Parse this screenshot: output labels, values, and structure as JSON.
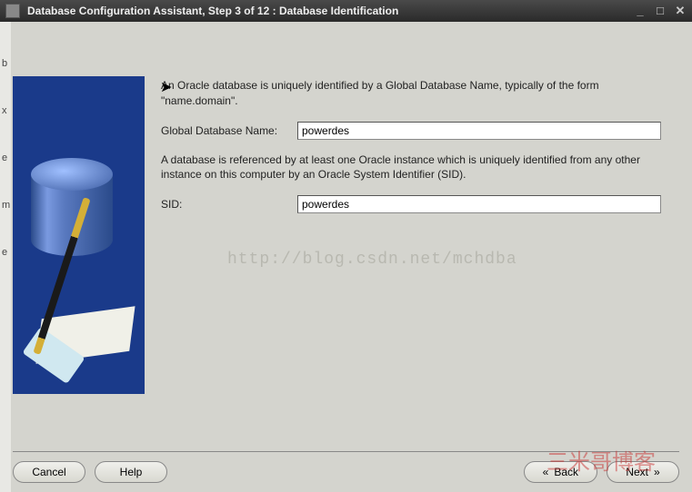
{
  "titlebar": {
    "title": "Database Configuration Assistant, Step 3 of 12 : Database Identification"
  },
  "description1": "An Oracle database is uniquely identified by a Global Database Name, typically of the form \"name.domain\".",
  "fields": {
    "gdn_label": "Global Database Name:",
    "gdn_value": "powerdes",
    "sid_label": "SID:",
    "sid_value": "powerdes"
  },
  "description2": "A database is referenced by at least one Oracle instance which is uniquely identified from any other instance on this computer by an Oracle System Identifier (SID).",
  "buttons": {
    "cancel": "Cancel",
    "help": "Help",
    "back": "Back",
    "next": "Next"
  },
  "watermark_url": "http://blog.csdn.net/mchdba",
  "watermark_cn": "三米哥博客",
  "left_letters": [
    "b",
    "x",
    "e",
    "m",
    "e"
  ]
}
